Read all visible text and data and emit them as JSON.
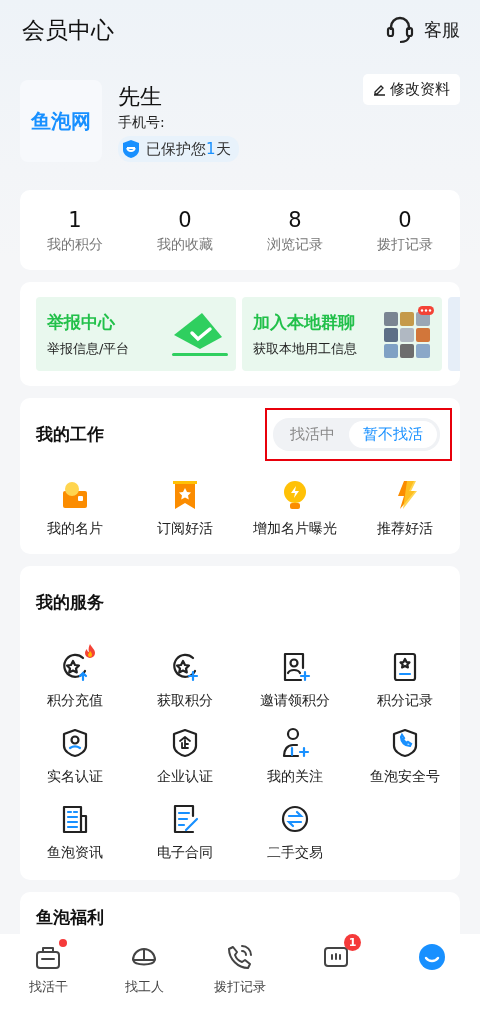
{
  "header": {
    "title": "会员中心",
    "service_label": "客服"
  },
  "profile": {
    "logo_text": "鱼泡网",
    "name": "先生",
    "phone_label": "手机号:",
    "protect_prefix": "已保护您",
    "protect_days": "1",
    "protect_suffix": "天",
    "edit_label": "修改资料"
  },
  "stats": [
    {
      "value": "1",
      "label": "我的积分"
    },
    {
      "value": "0",
      "label": "我的收藏"
    },
    {
      "value": "8",
      "label": "浏览记录"
    },
    {
      "value": "0",
      "label": "拨打记录"
    }
  ],
  "banners": [
    {
      "kind": "report",
      "title": "举报中心",
      "subtitle": "举报信息/平台"
    },
    {
      "kind": "group",
      "title": "加入本地群聊",
      "subtitle": "获取本地用工信息"
    }
  ],
  "work": {
    "title": "我的工作",
    "highlighted": true,
    "toggle": [
      {
        "label": "找活中",
        "selected": false
      },
      {
        "label": "暂不找活",
        "selected": true
      }
    ],
    "items": [
      {
        "kind": "card",
        "label": "我的名片"
      },
      {
        "kind": "ribbon",
        "label": "订阅好活"
      },
      {
        "kind": "bulb",
        "label": "增加名片曝光"
      },
      {
        "kind": "bolt",
        "label": "推荐好活"
      }
    ]
  },
  "services": {
    "title": "我的服务",
    "items": [
      {
        "kind": "star-up",
        "label": "积分充值",
        "hot": true
      },
      {
        "kind": "star-plus",
        "label": "获取积分",
        "hot": false
      },
      {
        "kind": "invite",
        "label": "邀请领积分",
        "hot": false
      },
      {
        "kind": "record",
        "label": "积分记录",
        "hot": false
      },
      {
        "kind": "shield-person",
        "label": "实名认证",
        "hot": false
      },
      {
        "kind": "shield-company",
        "label": "企业认证",
        "hot": false
      },
      {
        "kind": "follow",
        "label": "我的关注",
        "hot": false
      },
      {
        "kind": "shield-phone",
        "label": "鱼泡安全号",
        "hot": false
      },
      {
        "kind": "news",
        "label": "鱼泡资讯",
        "hot": false
      },
      {
        "kind": "contract",
        "label": "电子合同",
        "hot": false
      },
      {
        "kind": "trade",
        "label": "二手交易",
        "hot": false
      }
    ]
  },
  "next_card": {
    "title": "鱼泡福利"
  },
  "tabbar": [
    {
      "kind": "bag",
      "label": "找活干",
      "selected": false,
      "dot": true
    },
    {
      "kind": "helmet",
      "label": "找工人",
      "selected": false,
      "dot": false
    },
    {
      "kind": "phone",
      "label": "拨打记录",
      "selected": false,
      "dot": false
    },
    {
      "kind": "chat",
      "selected": false,
      "dot": false,
      "badge": "1"
    },
    {
      "kind": "me",
      "selected": true,
      "dot": false
    }
  ]
}
